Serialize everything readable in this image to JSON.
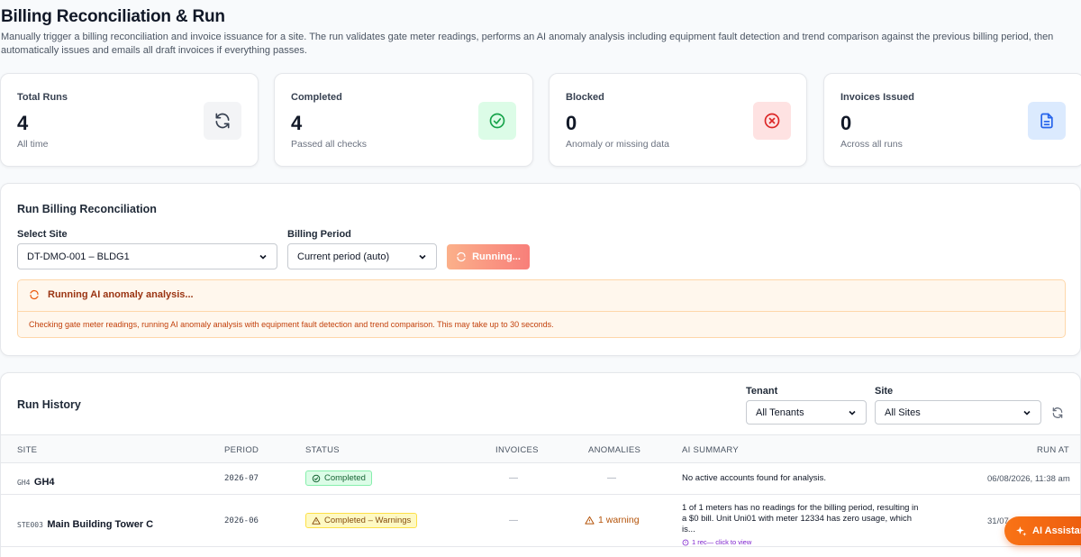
{
  "header": {
    "title": "Billing Reconciliation & Run",
    "description": "Manually trigger a billing reconciliation and invoice issuance for a site. The run validates gate meter readings, performs an AI anomaly analysis including equipment fault detection and trend comparison against the previous billing period, then automatically issues and emails all draft invoices if everything passes."
  },
  "stats": [
    {
      "label": "Total Runs",
      "value": "4",
      "sub": "All time",
      "icon": "refresh-icon",
      "color": "#f3f4f6"
    },
    {
      "label": "Completed",
      "value": "4",
      "sub": "Passed all checks",
      "icon": "check-circle-icon",
      "color": "#dcfce7"
    },
    {
      "label": "Blocked",
      "value": "0",
      "sub": "Anomaly or missing data",
      "icon": "x-circle-icon",
      "color": "#fee2e2"
    },
    {
      "label": "Invoices Issued",
      "value": "0",
      "sub": "Across all runs",
      "icon": "document-icon",
      "color": "#dbeafe"
    }
  ],
  "run_panel": {
    "title": "Run Billing Reconciliation",
    "site_label": "Select Site",
    "site_value": "DT-DMO-001 – BLDG1",
    "period_label": "Billing Period",
    "period_value": "Current period (auto)",
    "run_button": "Running...",
    "alert_title": "Running AI anomaly analysis...",
    "alert_message": "Checking gate meter readings, running AI anomaly analysis with equipment fault detection and trend comparison. This may take up to 30 seconds."
  },
  "history": {
    "title": "Run History",
    "tenant_label": "Tenant",
    "tenant_value": "All Tenants",
    "site_label": "Site",
    "site_value": "All Sites",
    "columns": {
      "site": "SITE",
      "period": "PERIOD",
      "status": "STATUS",
      "invoices": "INVOICES",
      "anomalies": "ANOMALIES",
      "summary": "AI SUMMARY",
      "run_at": "RUN AT"
    },
    "rows": [
      {
        "code": "GH4",
        "name": "GH4",
        "period": "2026-07",
        "status": "Completed",
        "invoices": "—",
        "anomalies": "—",
        "summary": "No active accounts found for analysis.",
        "rec": "",
        "run_at": "06/08/2026, 11:38 am"
      },
      {
        "code": "STE003",
        "name": "Main Building Tower C",
        "period": "2026-06",
        "status": "Completed – Warnings",
        "invoices": "—",
        "anomalies": "1 warning",
        "summary": "1 of 1 meters has no readings for the billing period, resulting in a $0 bill. Unit Uni01 with meter 12334 has zero usage, which is...",
        "rec": "1 rec— click to view",
        "run_at": "31/07"
      }
    ]
  },
  "ai_assistant": "AI Assistant"
}
